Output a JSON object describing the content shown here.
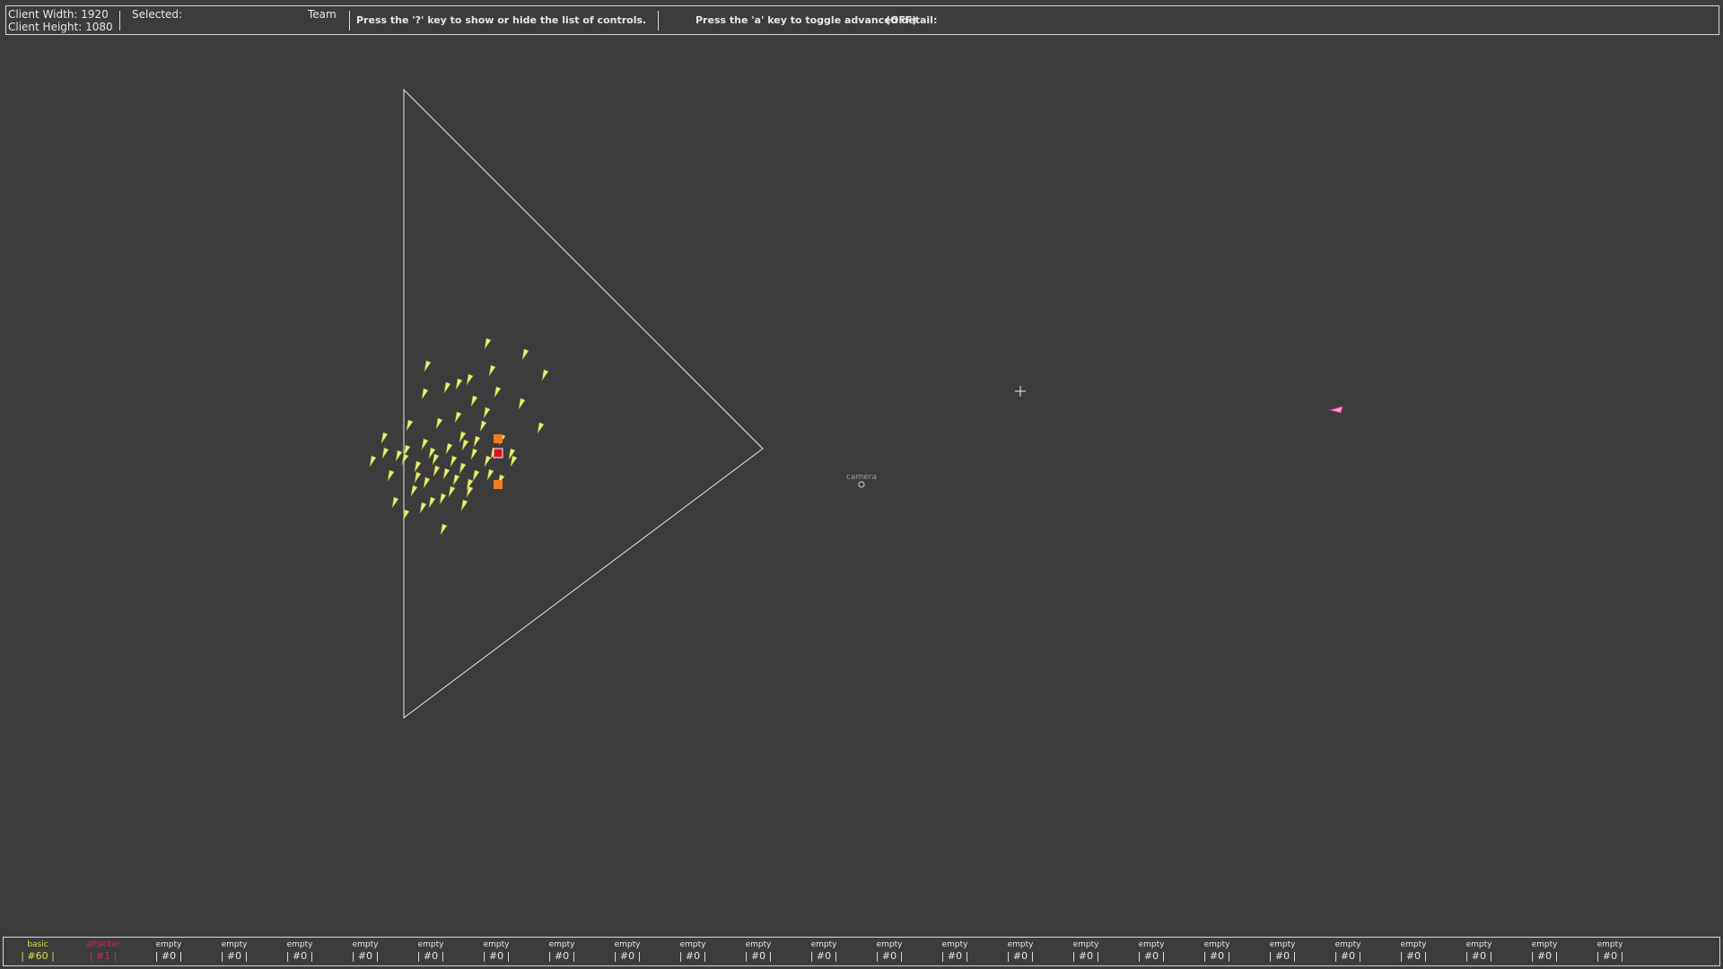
{
  "hud": {
    "client_width": "Client Width: 1920",
    "client_height": "Client Height: 1080",
    "selected_label": "Selected:",
    "team_label": "Team",
    "controls_hint": "Press the '?' key to show or hide the list of controls.",
    "advanced_hint": "Press the 'a' key to toggle advanced detail:",
    "advanced_state": "(OFF)"
  },
  "camera": {
    "label": "camera"
  },
  "colors": {
    "background": "#3c3c3c",
    "basic_unit": "#e6f07a",
    "attacker_unit": "#e0309a",
    "marker_orange": "#f07c1e",
    "marker_red": "#e8101c",
    "outline": "#e6e6e6"
  },
  "icons": {
    "cursor": "crosshair-icon",
    "camera": "camera-marker-icon"
  },
  "bottombar": {
    "slots": [
      {
        "type": "basic",
        "count": "| #60 |",
        "color": "#d8e04a"
      },
      {
        "type": "attacker",
        "count": "| #1 |",
        "color": "#c82a6a"
      },
      {
        "type": "empty",
        "count": "| #0 |",
        "color": "#e6e6e6"
      },
      {
        "type": "empty",
        "count": "| #0 |",
        "color": "#e6e6e6"
      },
      {
        "type": "empty",
        "count": "| #0 |",
        "color": "#e6e6e6"
      },
      {
        "type": "empty",
        "count": "| #0 |",
        "color": "#e6e6e6"
      },
      {
        "type": "empty",
        "count": "| #0 |",
        "color": "#e6e6e6"
      },
      {
        "type": "empty",
        "count": "| #0 |",
        "color": "#e6e6e6"
      },
      {
        "type": "empty",
        "count": "| #0 |",
        "color": "#e6e6e6"
      },
      {
        "type": "empty",
        "count": "| #0 |",
        "color": "#e6e6e6"
      },
      {
        "type": "empty",
        "count": "| #0 |",
        "color": "#e6e6e6"
      },
      {
        "type": "empty",
        "count": "| #0 |",
        "color": "#e6e6e6"
      },
      {
        "type": "empty",
        "count": "| #0 |",
        "color": "#e6e6e6"
      },
      {
        "type": "empty",
        "count": "| #0 |",
        "color": "#e6e6e6"
      },
      {
        "type": "empty",
        "count": "| #0 |",
        "color": "#e6e6e6"
      },
      {
        "type": "empty",
        "count": "| #0 |",
        "color": "#e6e6e6"
      },
      {
        "type": "empty",
        "count": "| #0 |",
        "color": "#e6e6e6"
      },
      {
        "type": "empty",
        "count": "| #0 |",
        "color": "#e6e6e6"
      },
      {
        "type": "empty",
        "count": "| #0 |",
        "color": "#e6e6e6"
      },
      {
        "type": "empty",
        "count": "| #0 |",
        "color": "#e6e6e6"
      },
      {
        "type": "empty",
        "count": "| #0 |",
        "color": "#e6e6e6"
      },
      {
        "type": "empty",
        "count": "| #0 |",
        "color": "#e6e6e6"
      },
      {
        "type": "empty",
        "count": "| #0 |",
        "color": "#e6e6e6"
      },
      {
        "type": "empty",
        "count": "| #0 |",
        "color": "#e6e6e6"
      },
      {
        "type": "empty",
        "count": "| #0 |",
        "color": "#e6e6e6"
      }
    ]
  }
}
